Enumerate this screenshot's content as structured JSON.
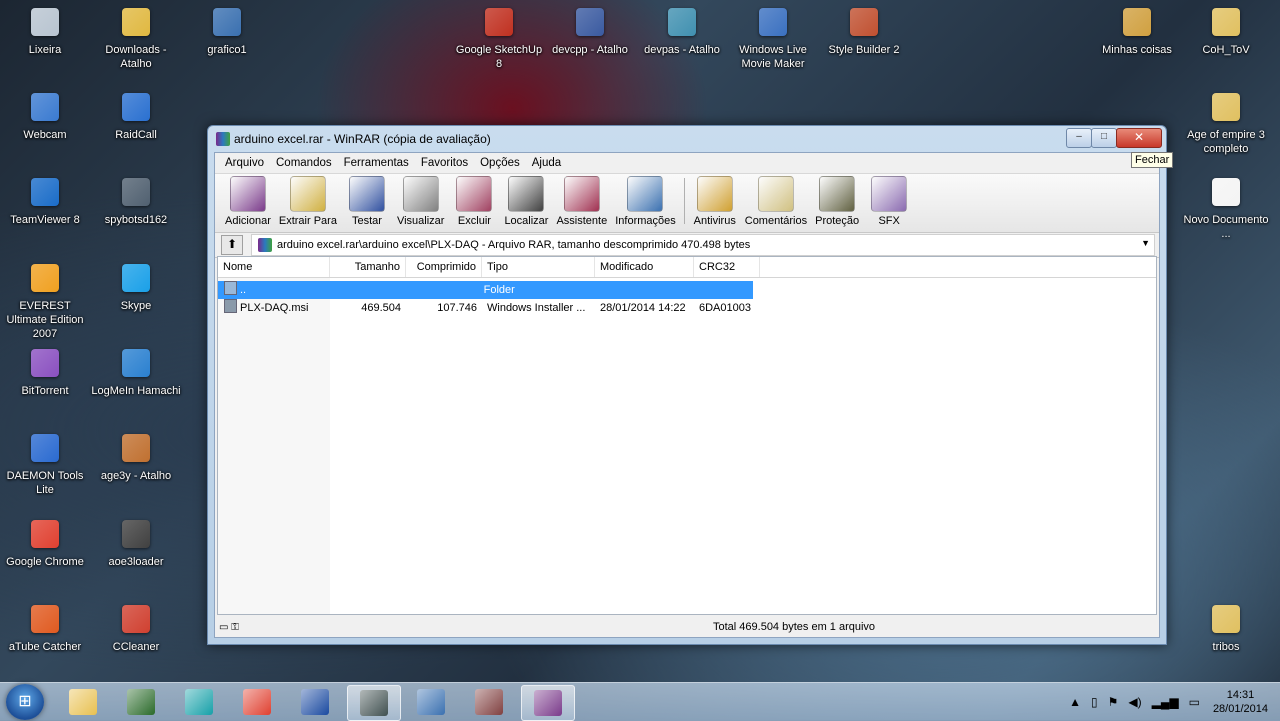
{
  "desktop": {
    "icons_left": [
      {
        "label": "Lixeira",
        "color": "#b8c4d0"
      },
      {
        "label": "Webcam",
        "color": "#3a7ad0"
      },
      {
        "label": "TeamViewer 8",
        "color": "#1a6cc8"
      },
      {
        "label": "EVEREST Ultimate Edition 2007",
        "color": "#f0a020"
      },
      {
        "label": "BitTorrent",
        "color": "#8a50c0"
      },
      {
        "label": "DAEMON Tools Lite",
        "color": "#2a6ad0"
      },
      {
        "label": "Google Chrome",
        "color": "#e04030"
      },
      {
        "label": "aTube Catcher",
        "color": "#e05a20"
      }
    ],
    "icons_col2": [
      {
        "label": "Downloads - Atalho",
        "color": "#e0b840"
      },
      {
        "label": "RaidCall",
        "color": "#2a70d0"
      },
      {
        "label": "spybotsd162",
        "color": "#506070"
      },
      {
        "label": "Skype",
        "color": "#1aa0e8"
      },
      {
        "label": "LogMeIn Hamachi",
        "color": "#2a80d0"
      },
      {
        "label": "age3y - Atalho",
        "color": "#c07030"
      },
      {
        "label": "aoe3loader",
        "color": "#404040"
      },
      {
        "label": "CCleaner",
        "color": "#d04030"
      }
    ],
    "icons_top": [
      {
        "label": "grafico1",
        "color": "#3a70b0"
      },
      {
        "label": "Google SketchUp 8",
        "color": "#c03020"
      },
      {
        "label": "devcpp - Atalho",
        "color": "#3a5aa0"
      },
      {
        "label": "devpas - Atalho",
        "color": "#4090b0"
      },
      {
        "label": "Windows Live Movie Maker",
        "color": "#3a70c0"
      },
      {
        "label": "Style Builder 2",
        "color": "#c05030"
      }
    ],
    "icons_right": [
      {
        "label": "Minhas coisas",
        "color": "#d0a040"
      },
      {
        "label": "CoH_ToV",
        "color": "#e0c060"
      },
      {
        "label": "Age of empire 3 completo",
        "color": "#e0c060"
      },
      {
        "label": "Novo Documento ...",
        "color": "#f4f4f4"
      },
      {
        "label": "tribos",
        "color": "#e0c060"
      }
    ]
  },
  "window": {
    "title": "arduino excel.rar - WinRAR (cópia de avaliação)",
    "tooltip": "Fechar",
    "buttons": {
      "minimize": "–",
      "maximize": "□",
      "close": "✕"
    },
    "menu": [
      "Arquivo",
      "Comandos",
      "Ferramentas",
      "Favoritos",
      "Opções",
      "Ajuda"
    ],
    "toolbar": [
      {
        "label": "Adicionar",
        "icon": "add-icon",
        "color": "#7a3a8a"
      },
      {
        "label": "Extrair Para",
        "icon": "extract-icon",
        "color": "#d0b040"
      },
      {
        "label": "Testar",
        "icon": "test-icon",
        "color": "#3050a0"
      },
      {
        "label": "Visualizar",
        "icon": "view-icon",
        "color": "#808080"
      },
      {
        "label": "Excluir",
        "icon": "delete-icon",
        "color": "#a04060"
      },
      {
        "label": "Localizar",
        "icon": "find-icon",
        "color": "#404040"
      },
      {
        "label": "Assistente",
        "icon": "wizard-icon",
        "color": "#a03050"
      },
      {
        "label": "Informações",
        "icon": "info-icon",
        "color": "#3a70b0"
      },
      {
        "label": "Antivirus",
        "icon": "antivirus-icon",
        "color": "#d0a030"
      },
      {
        "label": "Comentários",
        "icon": "comment-icon",
        "color": "#d0c080"
      },
      {
        "label": "Proteção",
        "icon": "protect-icon",
        "color": "#606040"
      },
      {
        "label": "SFX",
        "icon": "sfx-icon",
        "color": "#8a6ab0"
      }
    ],
    "address": "arduino excel.rar\\arduino excel\\PLX-DAQ - Arquivo RAR, tamanho descomprimido 470.498 bytes",
    "columns": [
      "Nome",
      "Tamanho",
      "Comprimido",
      "Tipo",
      "Modificado",
      "CRC32"
    ],
    "rows": [
      {
        "name": "..",
        "size": "",
        "packed": "",
        "type": "Folder",
        "modified": "",
        "crc": "",
        "selected": true
      },
      {
        "name": "PLX-DAQ.msi",
        "size": "469.504",
        "packed": "107.746",
        "type": "Windows Installer ...",
        "modified": "28/01/2014 14:22",
        "crc": "6DA01003",
        "selected": false
      }
    ],
    "status": "Total 469.504 bytes em 1 arquivo"
  },
  "taskbar": {
    "apps": [
      {
        "name": "explorer",
        "color": "#e8c050"
      },
      {
        "name": "performance-monitor",
        "color": "#2a6a2a"
      },
      {
        "name": "arduino",
        "color": "#16a0a8"
      },
      {
        "name": "chrome",
        "color": "#e04030"
      },
      {
        "name": "isis",
        "color": "#1a4aa0"
      },
      {
        "name": "app-6",
        "color": "#405050"
      },
      {
        "name": "python",
        "color": "#3a70b0"
      },
      {
        "name": "app-8",
        "color": "#804040"
      },
      {
        "name": "winrar",
        "color": "#7a3a8a"
      }
    ],
    "clock_time": "14:31",
    "clock_date": "28/01/2014"
  }
}
